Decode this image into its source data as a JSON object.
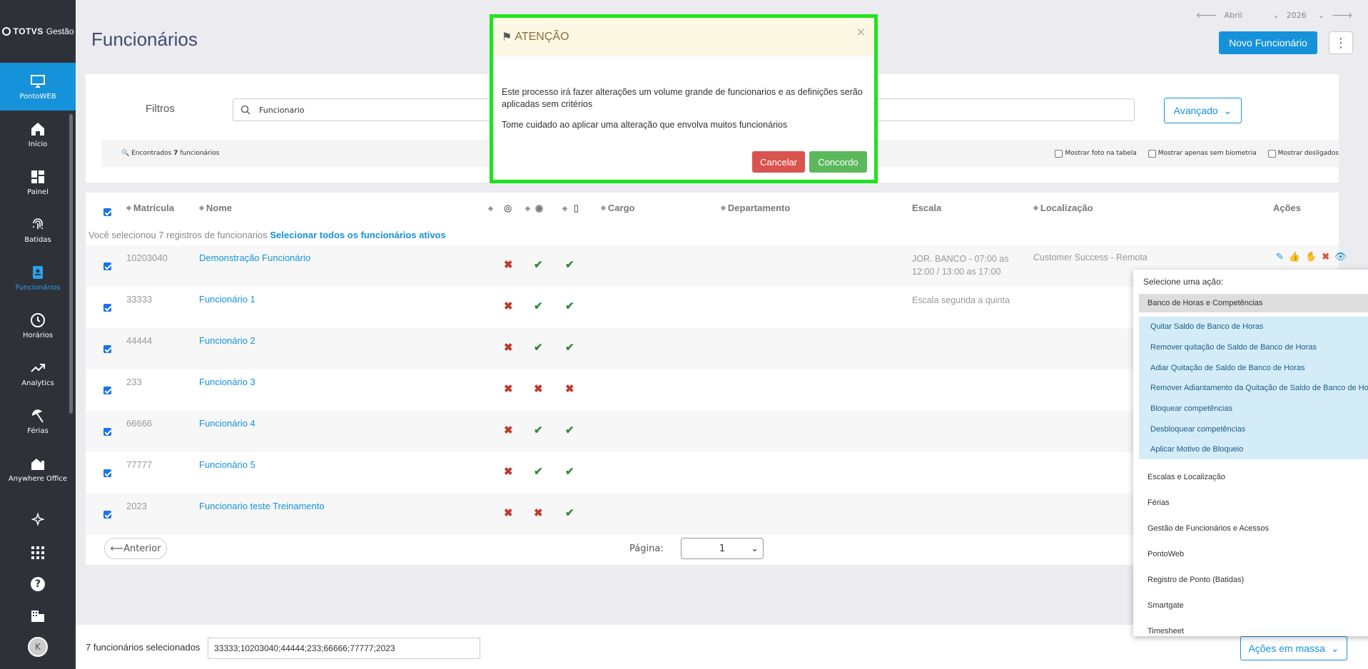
{
  "app": {
    "logo_brand": "TOTVS",
    "logo_product": "Gestão"
  },
  "sidebar": {
    "items": [
      {
        "label": "PontoWEB",
        "icon": "monitor-icon"
      },
      {
        "label": "Início",
        "icon": "home-icon"
      },
      {
        "label": "Painel",
        "icon": "dashboard-icon"
      },
      {
        "label": "Batidas",
        "icon": "fingerprint-icon"
      },
      {
        "label": "Funcionários",
        "icon": "badge-icon"
      },
      {
        "label": "Horários",
        "icon": "clock-icon"
      },
      {
        "label": "Analytics",
        "icon": "trending-icon"
      },
      {
        "label": "Férias",
        "icon": "beach-icon"
      },
      {
        "label": "Anywhere Office",
        "icon": "home-office-icon"
      }
    ],
    "avatar_initial": "K"
  },
  "header": {
    "title": "Funcionários",
    "month": "Abril",
    "year": "2026",
    "new_button": "Novo Funcionário"
  },
  "filters": {
    "label": "Filtros",
    "search_value": "Funcionario",
    "advanced_button": "Avançado",
    "found_prefix": "Encontrados",
    "found_count": "7",
    "found_suffix": "funcionários",
    "checks": [
      "Mostrar foto na tabela",
      "Mostrar apenas sem biometria",
      "Mostrar desligados"
    ]
  },
  "table": {
    "headers": {
      "matricula": "Matrícula",
      "nome": "Nome",
      "cargo": "Cargo",
      "departamento": "Departamento",
      "escala": "Escala",
      "localizacao": "Localização",
      "acoes": "Ações"
    },
    "selection_text": "Você selecionou 7 registros de funcionarios",
    "select_all_link": "Selecionar todos os funcionários ativos",
    "rows": [
      {
        "matricula": "10203040",
        "nome": "Demonstração Funcionário",
        "flags": [
          "x",
          "ok",
          "ok"
        ],
        "escala": "JOR. BANCO - 07:00 as 12:00 / 13:00 as 17:00",
        "localizacao": "Customer Success - Remota"
      },
      {
        "matricula": "33333",
        "nome": "Funcionário 1",
        "flags": [
          "x",
          "ok",
          "ok"
        ],
        "escala": "Escala segunda a quinta",
        "localizacao": ""
      },
      {
        "matricula": "44444",
        "nome": "Funcionário 2",
        "flags": [
          "x",
          "ok",
          "ok"
        ],
        "escala": "",
        "localizacao": ""
      },
      {
        "matricula": "233",
        "nome": "Funcionário 3",
        "flags": [
          "x",
          "x",
          "x"
        ],
        "escala": "",
        "localizacao": ""
      },
      {
        "matricula": "66666",
        "nome": "Funcionário 4",
        "flags": [
          "x",
          "ok",
          "ok"
        ],
        "escala": "",
        "localizacao": ""
      },
      {
        "matricula": "77777",
        "nome": "Funcionário 5",
        "flags": [
          "x",
          "ok",
          "ok"
        ],
        "escala": "",
        "localizacao": ""
      },
      {
        "matricula": "2023",
        "nome": "Funcionario teste Treinamento",
        "flags": [
          "x",
          "x",
          "ok"
        ],
        "escala": "",
        "localizacao": ""
      }
    ]
  },
  "pager": {
    "prev": "⟵Anterior",
    "label": "Página:",
    "value": "1"
  },
  "footer": {
    "count_text": "7 funcionários selecionados",
    "ids": "33333;10203040;44444;233;66666;77777;2023",
    "mass_button": "Ações em massa"
  },
  "dropdown": {
    "title": "Selecione uma ação:",
    "open_group": "Banco de Horas e Competências",
    "items": [
      "Quitar Saldo de Banco de Horas",
      "Remover quitação de Saldo de Banco de Horas",
      "Adiar Quitação de Saldo de Banco de Horas",
      "Remover Adiantamento da Quitação de Saldo de Banco de Horas",
      "Bloquear competências",
      "Desbloquear competências",
      "Aplicar Motivo de Bloqueio"
    ],
    "sections": [
      "Escalas e Localização",
      "Férias",
      "Gestão de Funcionários e Acessos",
      "PontoWeb",
      "Registro de Ponto (Batidas)",
      "Smartgate",
      "Timesheet"
    ]
  },
  "modal": {
    "title": "ATENÇÃO",
    "body1": "Este processo irá fazer alterações um volume grande de funcionarios e as definições serão aplicadas sem critérios",
    "body2": "Tome cuidado ao aplicar uma alteração que envolva muitos funcionários",
    "cancel": "Cancelar",
    "confirm": "Concordo"
  },
  "colors": {
    "accent": "#1592d9",
    "sidebar": "#2f3139",
    "highlight": "#1fe21f",
    "danger": "#d9534f",
    "success": "#5cb85c"
  }
}
